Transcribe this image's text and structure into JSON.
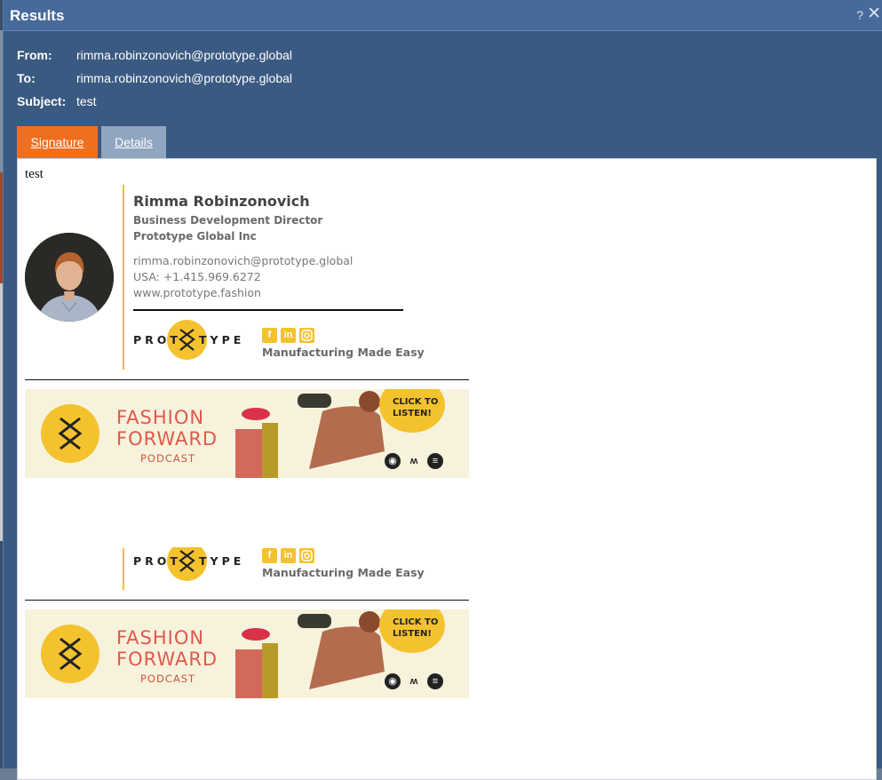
{
  "window": {
    "title": "Results",
    "help_label": "?",
    "close_label": "✕"
  },
  "email": {
    "from_label": "From:",
    "from_value": "rimma.robinzonovich@prototype.global",
    "to_label": "To:",
    "to_value": "rimma.robinzonovich@prototype.global",
    "subject_label": "Subject:",
    "subject_value": "test"
  },
  "tabs": [
    {
      "label": "Signature",
      "active": true
    },
    {
      "label": "Details",
      "active": false
    }
  ],
  "body": {
    "text": "test"
  },
  "signature": {
    "name": "Rimma Robinzonovich",
    "title": "Business Development Director",
    "company": "Prototype Global Inc",
    "email": "rimma.robinzonovich@prototype.global",
    "phone": "USA: +1.415.969.6272",
    "website": "www.prototype.fashion",
    "logo_text_left": "PROT",
    "logo_text_right": "TYPE",
    "tagline": "Manufacturing Made Easy",
    "social_icons": [
      "facebook-icon",
      "linkedin-icon",
      "instagram-icon"
    ]
  },
  "banner": {
    "title_line1": "FASHION",
    "title_line2": "FORWARD",
    "subtitle": "PODCAST",
    "cta_line1": "CLICK TO",
    "cta_line2": "LISTEN!",
    "platform_icons": [
      "apple-podcasts-icon",
      "audible-icon",
      "spotify-icon"
    ]
  },
  "colors": {
    "title_bar": "#466b9a",
    "dialog_bg": "#3a5a82",
    "active_tab": "#f06e1f",
    "inactive_tab": "#8fa5c0",
    "accent_yellow": "#f4c22e",
    "banner_red": "#e2584c",
    "banner_bg": "#f7f2dc"
  }
}
